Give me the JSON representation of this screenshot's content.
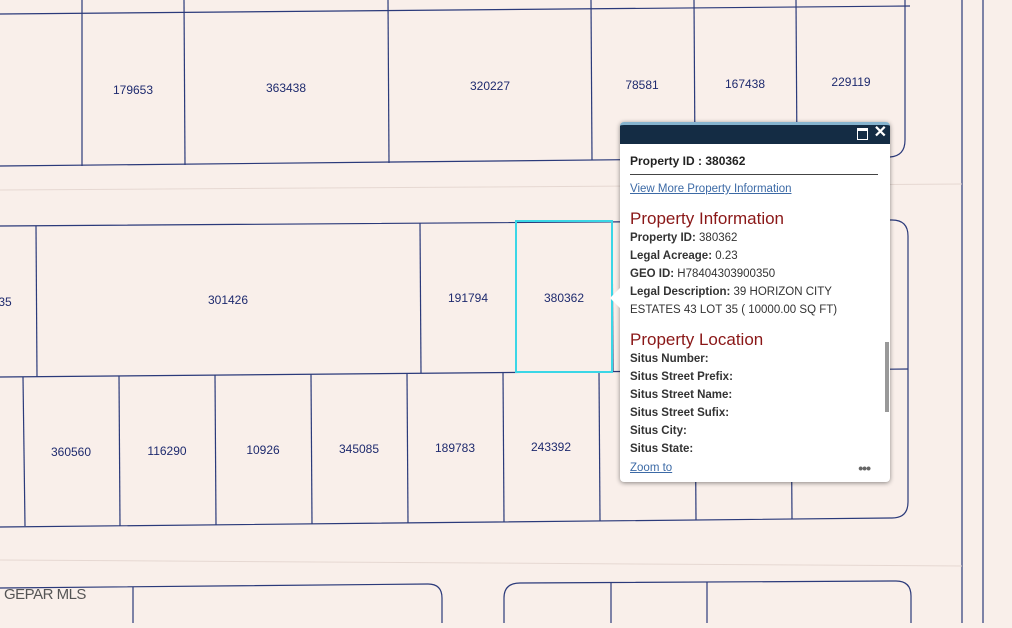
{
  "map": {
    "parcels": [
      {
        "label": "179653"
      },
      {
        "label": "363438"
      },
      {
        "label": "320227"
      },
      {
        "label": "78581"
      },
      {
        "label": "167438"
      },
      {
        "label": "229119"
      },
      {
        "label": "35"
      },
      {
        "label": "301426"
      },
      {
        "label": "191794"
      },
      {
        "label": "380362"
      },
      {
        "label": "360560"
      },
      {
        "label": "116290"
      },
      {
        "label": "10926"
      },
      {
        "label": "345085"
      },
      {
        "label": "189783"
      },
      {
        "label": "243392"
      }
    ],
    "selected_parcel": "380362",
    "watermark": "GEPAR MLS"
  },
  "popup": {
    "title_value": "Property ID : 380362",
    "more_link": "View More Property Information",
    "section1": "Property Information",
    "info": [
      {
        "label": "Property ID:",
        "value": "380362"
      },
      {
        "label": "Legal Acreage:",
        "value": "0.23"
      },
      {
        "label": "GEO ID:",
        "value": "H78404303900350"
      },
      {
        "label": "Legal Description:",
        "value": "39 HORIZON CITY ESTATES 43 LOT 35 ( 10000.00 SQ FT)"
      }
    ],
    "section2": "Property Location",
    "location": [
      {
        "label": "Situs Number:",
        "value": ""
      },
      {
        "label": "Situs Street Prefix:",
        "value": ""
      },
      {
        "label": "Situs Street Name:",
        "value": ""
      },
      {
        "label": "Situs Street Sufix:",
        "value": ""
      },
      {
        "label": "Situs City:",
        "value": ""
      },
      {
        "label": "Situs State:",
        "value": ""
      }
    ],
    "zoom_label": "Zoom to",
    "more_icon": "ellipsis-icon",
    "maximize_icon": "maximize-icon",
    "close_icon": "close-icon"
  },
  "colors": {
    "background": "#f9efea",
    "parcel_line": "#2b3a7a",
    "selected": "#3ad6e6",
    "popup_header": "#142c44",
    "section_title": "#8a1717"
  }
}
